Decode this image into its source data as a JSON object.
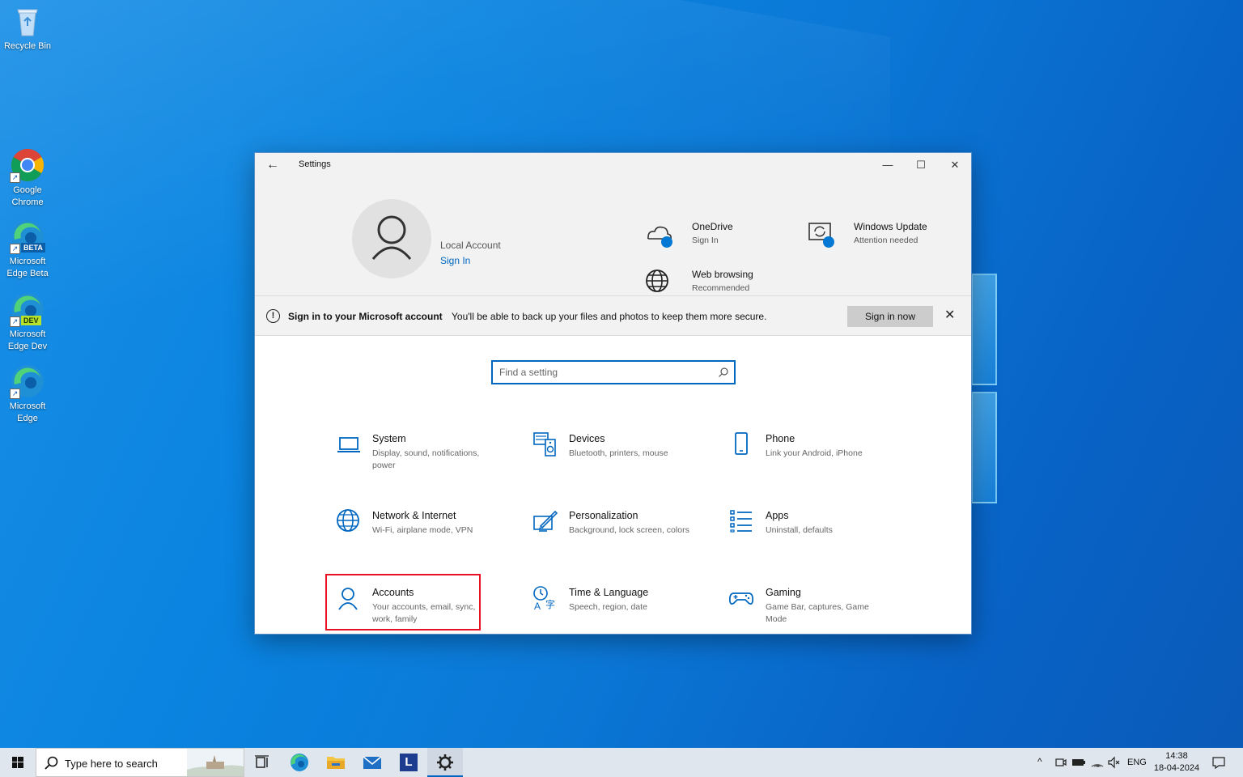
{
  "desktop": {
    "icons": [
      {
        "label": "Recycle Bin"
      },
      {
        "label": "Google Chrome"
      },
      {
        "label": "Microsoft Edge Beta",
        "badge": "BETA"
      },
      {
        "label": "Microsoft Edge Dev",
        "badge": "DEV"
      },
      {
        "label": "Microsoft Edge"
      }
    ]
  },
  "window": {
    "title": "Settings",
    "controls": {
      "minimize": "—",
      "maximize": "☐",
      "close": "✕"
    },
    "account": {
      "name": "Local Account",
      "signin": "Sign In"
    },
    "hero_items": [
      {
        "title": "OneDrive",
        "sub": "Sign In",
        "icon": "cloud-icon"
      },
      {
        "title": "Windows Update",
        "sub": "Attention needed",
        "icon": "update-icon"
      },
      {
        "title": "Web browsing",
        "sub": "Recommended settings",
        "icon": "globe-icon"
      }
    ],
    "banner": {
      "title": "Sign in to your Microsoft account",
      "desc": "You'll be able to back up your files and photos to keep them more secure.",
      "button": "Sign in now"
    },
    "search": {
      "placeholder": "Find a setting"
    },
    "tiles": [
      {
        "title": "System",
        "desc": "Display, sound, notifications, power",
        "icon": "laptop-icon"
      },
      {
        "title": "Devices",
        "desc": "Bluetooth, printers, mouse",
        "icon": "devices-icon"
      },
      {
        "title": "Phone",
        "desc": "Link your Android, iPhone",
        "icon": "phone-icon"
      },
      {
        "title": "Network & Internet",
        "desc": "Wi-Fi, airplane mode, VPN",
        "icon": "globe-icon"
      },
      {
        "title": "Personalization",
        "desc": "Background, lock screen, colors",
        "icon": "paint-icon"
      },
      {
        "title": "Apps",
        "desc": "Uninstall, defaults",
        "icon": "apps-list-icon"
      },
      {
        "title": "Accounts",
        "desc": "Your accounts, email, sync, work, family",
        "icon": "person-icon"
      },
      {
        "title": "Time & Language",
        "desc": "Speech, region, date",
        "icon": "time-language-icon"
      },
      {
        "title": "Gaming",
        "desc": "Game Bar, captures, Game Mode",
        "icon": "gamepad-icon"
      }
    ]
  },
  "taskbar": {
    "search_text": "Type here to search",
    "pinned_letter": "L",
    "language": "ENG",
    "time": "14:38",
    "date": "18-04-2024"
  },
  "colors": {
    "accent": "#0067c0",
    "highlight": "#e81123"
  }
}
